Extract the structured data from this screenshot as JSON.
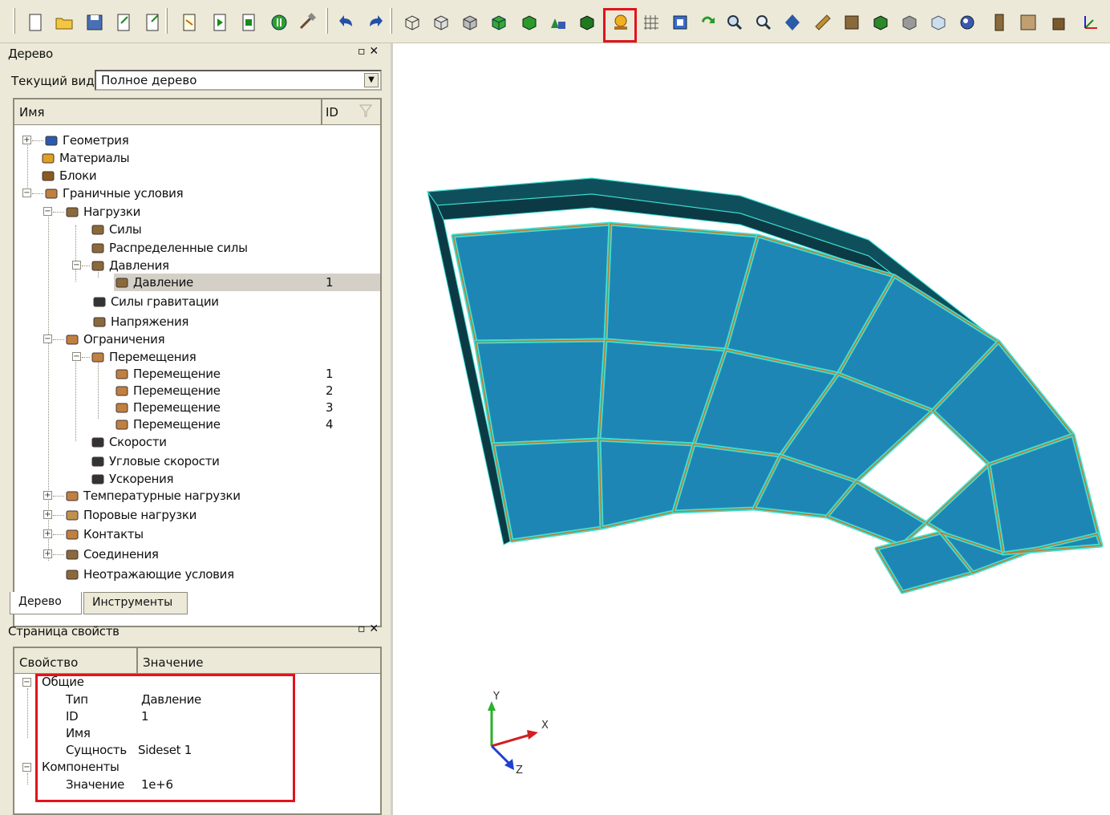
{
  "toolbar": {
    "icons": [
      "new-icon",
      "open-folder-icon",
      "save-icon",
      "import-icon",
      "export-icon",
      "script-icon",
      "run-icon",
      "run-file-icon",
      "stop-icon",
      "hammer-icon",
      "undo-icon",
      "redo-icon",
      "wireframe-view-icon",
      "hidden-line-view-icon",
      "shaded-wire-icon",
      "shaded-view-icon",
      "solid-view-icon",
      "geometry-icon",
      "block-icon",
      "boundary-condition-icon",
      "mesh-grid-icon",
      "select-icon",
      "rotate-icon",
      "zoom-in-icon",
      "zoom-out-icon",
      "fit-view-icon",
      "cut-plane-icon",
      "material-icon",
      "green-block-icon",
      "gray-block-icon",
      "transparency-icon",
      "lighting-icon",
      "column-icon",
      "save-image-icon",
      "box-icon",
      "axes-icon"
    ],
    "highlighted_icon": "boundary-condition-icon"
  },
  "tree_panel": {
    "title": "Дерево",
    "current_view_label": "Текущий вид",
    "current_view_value": "Полное дерево",
    "col_name": "Имя",
    "col_id": "ID",
    "items": [
      {
        "label": "Геометрия",
        "icon": "geometry-icon",
        "id": ""
      },
      {
        "label": "Материалы",
        "icon": "materials-icon",
        "id": ""
      },
      {
        "label": "Блоки",
        "icon": "blocks-icon",
        "id": ""
      },
      {
        "label": "Граничные условия",
        "icon": "boundary-conditions-icon",
        "id": ""
      },
      {
        "label": "Нагрузки",
        "icon": "loads-icon",
        "id": ""
      },
      {
        "label": "Силы",
        "icon": "force-icon",
        "id": ""
      },
      {
        "label": "Распределенные силы",
        "icon": "distributed-force-icon",
        "id": ""
      },
      {
        "label": "Давления",
        "icon": "pressures-icon",
        "id": ""
      },
      {
        "label": "Давление",
        "icon": "pressure-icon",
        "id": "1"
      },
      {
        "label": "Силы гравитации",
        "icon": "gravity-icon",
        "id": ""
      },
      {
        "label": "Напряжения",
        "icon": "stress-icon",
        "id": ""
      },
      {
        "label": "Ограничения",
        "icon": "constraints-icon",
        "id": ""
      },
      {
        "label": "Перемещения",
        "icon": "displacements-icon",
        "id": ""
      },
      {
        "label": "Перемещение",
        "icon": "displacement-icon",
        "id": "1"
      },
      {
        "label": "Перемещение",
        "icon": "displacement-icon",
        "id": "2"
      },
      {
        "label": "Перемещение",
        "icon": "displacement-icon",
        "id": "3"
      },
      {
        "label": "Перемещение",
        "icon": "displacement-icon",
        "id": "4"
      },
      {
        "label": "Скорости",
        "icon": "velocity-icon",
        "id": ""
      },
      {
        "label": "Угловые скорости",
        "icon": "angular-velocity-icon",
        "id": ""
      },
      {
        "label": "Ускорения",
        "icon": "acceleration-icon",
        "id": ""
      },
      {
        "label": "Температурные нагрузки",
        "icon": "temperature-icon",
        "id": ""
      },
      {
        "label": "Поровые нагрузки",
        "icon": "pore-pressure-icon",
        "id": ""
      },
      {
        "label": "Контакты",
        "icon": "contacts-icon",
        "id": ""
      },
      {
        "label": "Соединения",
        "icon": "connections-icon",
        "id": ""
      },
      {
        "label": "Неотражающие условия",
        "icon": "non-reflecting-icon",
        "id": ""
      }
    ],
    "tabs": [
      "Дерево",
      "Инструменты"
    ]
  },
  "props_panel": {
    "title": "Страница свойств",
    "col_property": "Свойство",
    "col_value": "Значение",
    "group_general": "Общие",
    "rows_general": [
      {
        "name": "Тип",
        "value": "Давление"
      },
      {
        "name": "ID",
        "value": "1"
      },
      {
        "name": "Имя",
        "value": ""
      },
      {
        "name": "Сущность",
        "value": "Sideset 1"
      }
    ],
    "group_components": "Компоненты",
    "rows_components": [
      {
        "name": "Значение",
        "value": "1e+6"
      }
    ]
  },
  "viewport": {
    "axis_labels": {
      "x": "X",
      "y": "Y",
      "z": "Z"
    },
    "colors": {
      "face": "#1e86b4",
      "face_dark": "#0f4f5c",
      "edge": "#3ee0d6",
      "seam": "#c07a2a"
    }
  }
}
